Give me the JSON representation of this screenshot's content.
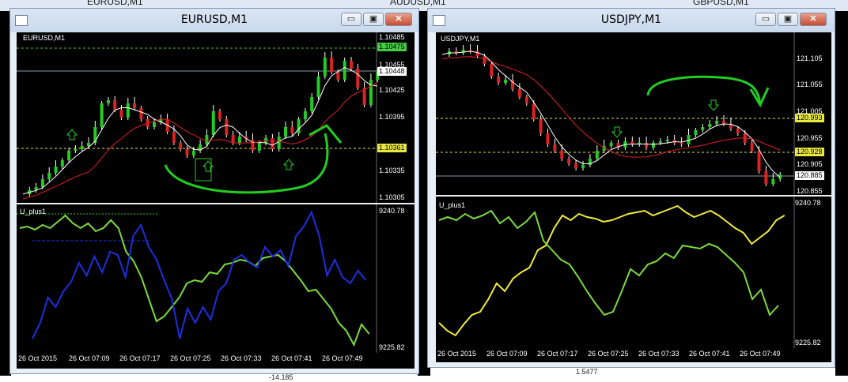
{
  "background_titles": {
    "left": "EURUSD,M1",
    "middle": "AUDUSD,M1",
    "right": "GBPUSD,M1"
  },
  "bottom_strip": {
    "left": "-14.185",
    "right": "1.5477"
  },
  "colors": {
    "bull": "#22cc22",
    "bear": "#dd2222",
    "ma_red": "#e02020",
    "ma_white": "#ffffff",
    "osc_green": "#7cdb3c",
    "osc_blue": "#1c2fe0",
    "osc_yellow": "#f0ea3a",
    "level_yellow": "#e8e840",
    "level_green": "#44cc44"
  },
  "windows": [
    {
      "title": "EURUSD,M1",
      "symbol_caption": "EURUSD,M1",
      "indicator_caption": "U_plus1",
      "price_scale": [
        "1.10485",
        "1.10455",
        "1.10425",
        "1.10395",
        "1.10365",
        "1.10335",
        "1.10305"
      ],
      "price_tags": [
        {
          "text": "1.10475",
          "style": "green"
        },
        {
          "text": "1.10448",
          "style": "white"
        },
        {
          "text": "1.10361",
          "style": "yellow"
        }
      ],
      "indicator_scale": {
        "max": "9240.78",
        "min": "9225.82"
      },
      "time_axis": [
        "26 Oct 2015",
        "26 Oct 07:09",
        "26 Oct 07:17",
        "26 Oct 07:25",
        "26 Oct 07:33",
        "26 Oct 07:41",
        "26 Oct 07:49"
      ],
      "arrow_icons": [
        "up-arrow",
        "up-arrow",
        "up-arrow"
      ]
    },
    {
      "title": "USDJPY,M1",
      "symbol_caption": "USDJPY,M1",
      "indicator_caption": "U_plus1",
      "price_scale": [
        "121.105",
        "121.055",
        "121.005",
        "120.955",
        "120.905",
        "120.855"
      ],
      "price_tags": [
        {
          "text": "120.993",
          "style": "yellow"
        },
        {
          "text": "120.928",
          "style": "yellow"
        },
        {
          "text": "120.885",
          "style": "white"
        }
      ],
      "indicator_scale": {
        "max": "9240.78",
        "min": "9225.82"
      },
      "time_axis": [
        "26 Oct 2015",
        "26 Oct 07:09",
        "26 Oct 07:17",
        "26 Oct 07:25",
        "26 Oct 07:33",
        "26 Oct 07:41",
        "26 Oct 07:49"
      ],
      "arrow_icons": [
        "down-arrow",
        "down-arrow"
      ]
    }
  ],
  "window_buttons": {
    "minimize": "▭",
    "maximize": "▣",
    "close": "✕"
  }
}
